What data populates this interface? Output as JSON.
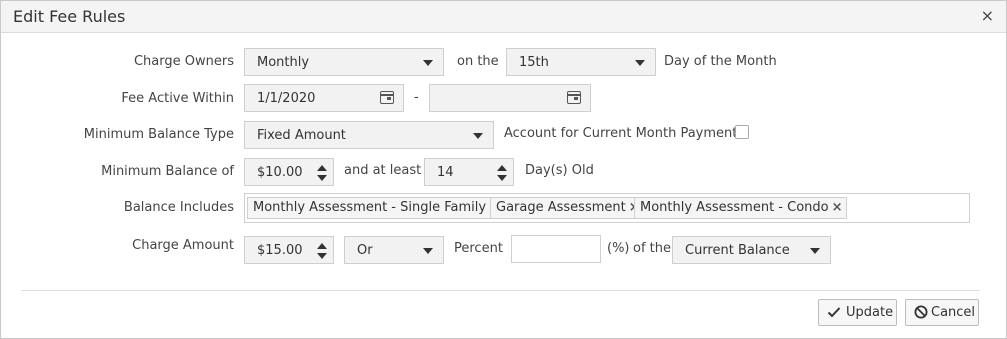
{
  "dialog": {
    "title": "Edit Fee Rules",
    "close_glyph": "×"
  },
  "form": {
    "charge_owners": {
      "label": "Charge Owners",
      "frequency": "Monthly",
      "on_the": "on the",
      "day": "15th",
      "day_suffix": "Day of the Month"
    },
    "fee_active": {
      "label": "Fee Active Within",
      "start_date": "1/1/2020",
      "separator": "-",
      "end_date": ""
    },
    "min_balance_type": {
      "label": "Minimum Balance Type",
      "value": "Fixed Amount",
      "current_month_label": "Account for Current Month Payment",
      "current_month_checked": false
    },
    "min_balance": {
      "label": "Minimum Balance of",
      "amount": "$10.00",
      "and_at_least": "and at least",
      "days": "14",
      "days_suffix": "Day(s) Old"
    },
    "balance_includes": {
      "label": "Balance Includes",
      "tags": [
        "Monthly Assessment - Single Family",
        "Garage Assessment",
        "Monthly Assessment - Condo"
      ]
    },
    "charge_amount": {
      "label": "Charge Amount",
      "amount": "$15.00",
      "operator": "Or",
      "percent_label": "Percent",
      "percent_value": "",
      "percent_unit": "(%)",
      "of_the": "of the",
      "basis": "Current Balance"
    }
  },
  "footer": {
    "update_label": "Update",
    "cancel_label": "Cancel"
  },
  "icons": {
    "tag_remove": "×"
  }
}
